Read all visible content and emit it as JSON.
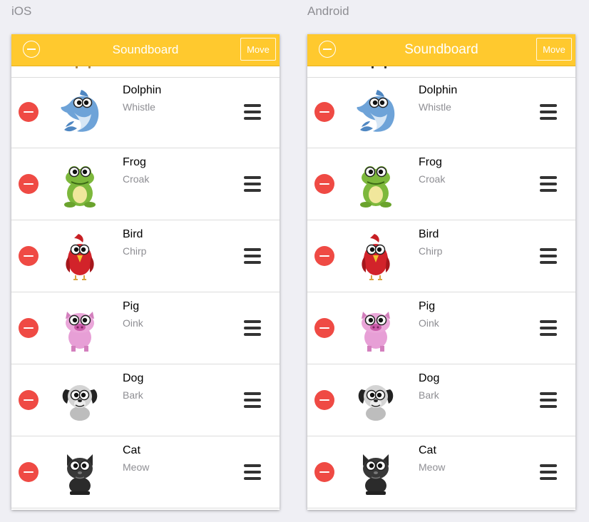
{
  "platforms": [
    {
      "label": "iOS",
      "title": "Soundboard",
      "move_label": "Move",
      "items": [
        {
          "name": "Dolphin",
          "sound": "Whistle",
          "icon": "dolphin-icon"
        },
        {
          "name": "Frog",
          "sound": "Croak",
          "icon": "frog-icon"
        },
        {
          "name": "Bird",
          "sound": "Chirp",
          "icon": "bird-icon"
        },
        {
          "name": "Pig",
          "sound": "Oink",
          "icon": "pig-icon"
        },
        {
          "name": "Dog",
          "sound": "Bark",
          "icon": "dog-icon"
        },
        {
          "name": "Cat",
          "sound": "Meow",
          "icon": "cat-icon"
        }
      ]
    },
    {
      "label": "Android",
      "title": "Soundboard",
      "move_label": "Move",
      "items": [
        {
          "name": "Dolphin",
          "sound": "Whistle",
          "icon": "dolphin-icon"
        },
        {
          "name": "Frog",
          "sound": "Croak",
          "icon": "frog-icon"
        },
        {
          "name": "Bird",
          "sound": "Chirp",
          "icon": "bird-icon"
        },
        {
          "name": "Pig",
          "sound": "Oink",
          "icon": "pig-icon"
        },
        {
          "name": "Dog",
          "sound": "Bark",
          "icon": "dog-icon"
        },
        {
          "name": "Cat",
          "sound": "Meow",
          "icon": "cat-icon"
        }
      ]
    }
  ],
  "colors": {
    "header": "#ffc92e",
    "delete": "#ef4a44",
    "background": "#efeff4"
  }
}
